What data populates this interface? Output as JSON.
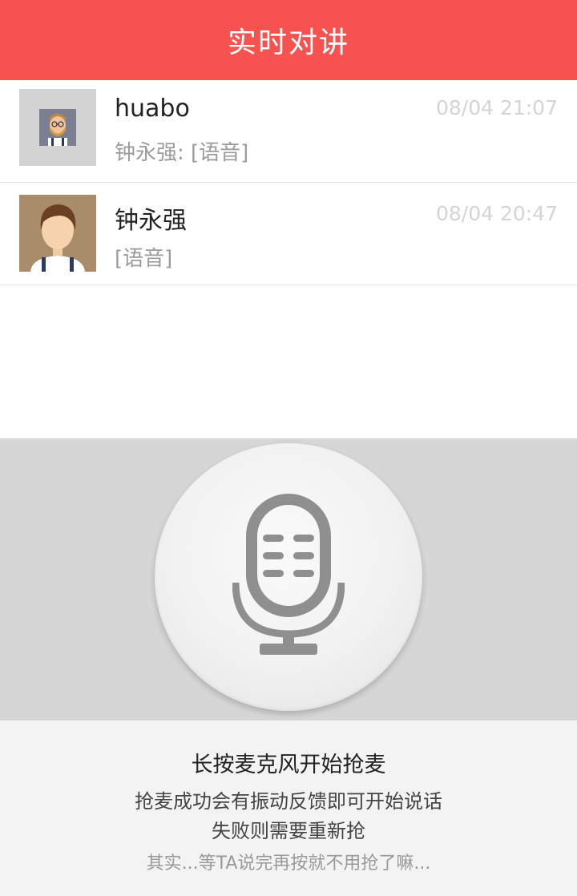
{
  "header": {
    "title": "实时对讲"
  },
  "conversations": [
    {
      "name": "huabo",
      "preview": "钟永强: [语音]",
      "time": "08/04 21:07",
      "avatar_icon": "bearded-man-avatar-icon"
    },
    {
      "name": "钟永强",
      "preview": "[语音]",
      "time": "08/04 20:47",
      "avatar_icon": "boy-avatar-icon"
    }
  ],
  "mic": {
    "icon": "microphone-icon"
  },
  "tips": {
    "line1": "长按麦克风开始抢麦",
    "line2": "抢麦成功会有振动反馈即可开始说话",
    "line3": "失败则需要重新抢",
    "line4": "其实...等TA说完再按就不用抢了嘛..."
  },
  "colors": {
    "header_bg": "#f6524f",
    "mic_panel_bg": "#d6d6d6",
    "tips_bg": "#f3f3f3"
  }
}
